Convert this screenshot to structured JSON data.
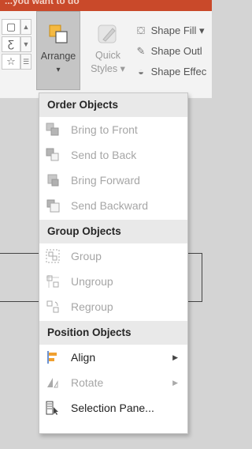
{
  "window": {
    "title_fragment": "...you want to do"
  },
  "ribbon": {
    "arrange_label": "Arrange",
    "arrange_dropdown": "▾",
    "quick_styles_label_1": "Quick",
    "quick_styles_label_2": "Styles ▾",
    "shape_fill": "Shape Fill ▾",
    "shape_outline": "Shape Outl",
    "shape_effects": "Shape Effec"
  },
  "menu": {
    "sections": [
      {
        "header": "Order Objects",
        "items": [
          {
            "label": "Bring to Front",
            "enabled": false,
            "icon": "bring-to-front-icon"
          },
          {
            "label": "Send to Back",
            "enabled": false,
            "icon": "send-to-back-icon"
          },
          {
            "label": "Bring Forward",
            "enabled": false,
            "icon": "bring-forward-icon"
          },
          {
            "label": "Send Backward",
            "enabled": false,
            "icon": "send-backward-icon"
          }
        ]
      },
      {
        "header": "Group Objects",
        "items": [
          {
            "label": "Group",
            "enabled": false,
            "icon": "group-icon"
          },
          {
            "label": "Ungroup",
            "enabled": false,
            "icon": "ungroup-icon"
          },
          {
            "label": "Regroup",
            "enabled": false,
            "icon": "regroup-icon"
          }
        ]
      },
      {
        "header": "Position Objects",
        "items": [
          {
            "label": "Align",
            "enabled": true,
            "icon": "align-icon",
            "submenu": true
          },
          {
            "label": "Rotate",
            "enabled": false,
            "icon": "rotate-icon",
            "submenu": true
          },
          {
            "label": "Selection Pane...",
            "enabled": true,
            "icon": "selection-pane-icon"
          }
        ]
      }
    ],
    "submenu_arrow": "▶"
  },
  "colors": {
    "title_bar": "#c9492a",
    "ribbon_bg": "#f3f3f3",
    "menu_header_bg": "#e9e9e9",
    "disabled_text": "#a6a6a6",
    "enabled_text": "#1f1f1f",
    "align_accent": "#f0a030",
    "canvas_bg": "#d4d4d4"
  }
}
